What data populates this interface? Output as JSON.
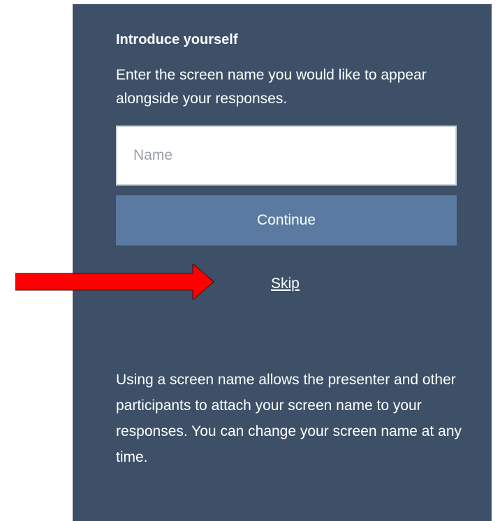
{
  "dialog": {
    "heading": "Introduce yourself",
    "intro_text": "Enter the screen name you would like to appear alongside your responses.",
    "name_input": {
      "placeholder": "Name",
      "value": ""
    },
    "continue_label": "Continue",
    "skip_label": "Skip",
    "info_text": "Using a screen name allows the presenter and other participants to attach your screen name to your responses. You can change your screen name at any time."
  },
  "annotation": {
    "icon": "right-arrow-icon",
    "color": "#ff0000"
  },
  "colors": {
    "panel_background": "#3d5068",
    "button_background": "#5a7aa1",
    "text": "#ffffff"
  }
}
